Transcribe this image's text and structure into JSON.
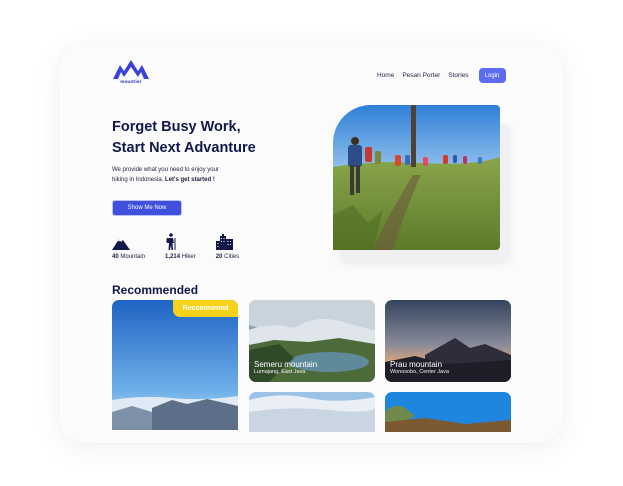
{
  "brand": {
    "logo_text": "mountier",
    "accent": "#3f50dc"
  },
  "nav": {
    "items": [
      {
        "label": "Home"
      },
      {
        "label": "Pesan Porter"
      },
      {
        "label": "Stories"
      }
    ],
    "login_label": "Login"
  },
  "hero": {
    "title_line1": "Forget Busy Work,",
    "title_line2": "Start Next Advanture",
    "subtitle_line1": "We provide what you need to enjoy your",
    "subtitle_line2_pre": "hiking in Indonesia. ",
    "subtitle_line2_bold": "Let's get started !",
    "cta_label": "Show Me Now",
    "stats": [
      {
        "icon": "mountain-icon",
        "value": "40",
        "label": "Mountain"
      },
      {
        "icon": "hiker-icon",
        "value": "1,214",
        "label": "Hiker"
      },
      {
        "icon": "city-icon",
        "value": "20",
        "label": "Cities"
      }
    ]
  },
  "recommended": {
    "title": "Recommended",
    "badge": "Recommened",
    "cards": [
      {
        "name": "Semeru mountain",
        "location": "Lumajang, East Java"
      },
      {
        "name": "Prau mountain",
        "location": "Wonosobo, Center Java"
      }
    ]
  }
}
